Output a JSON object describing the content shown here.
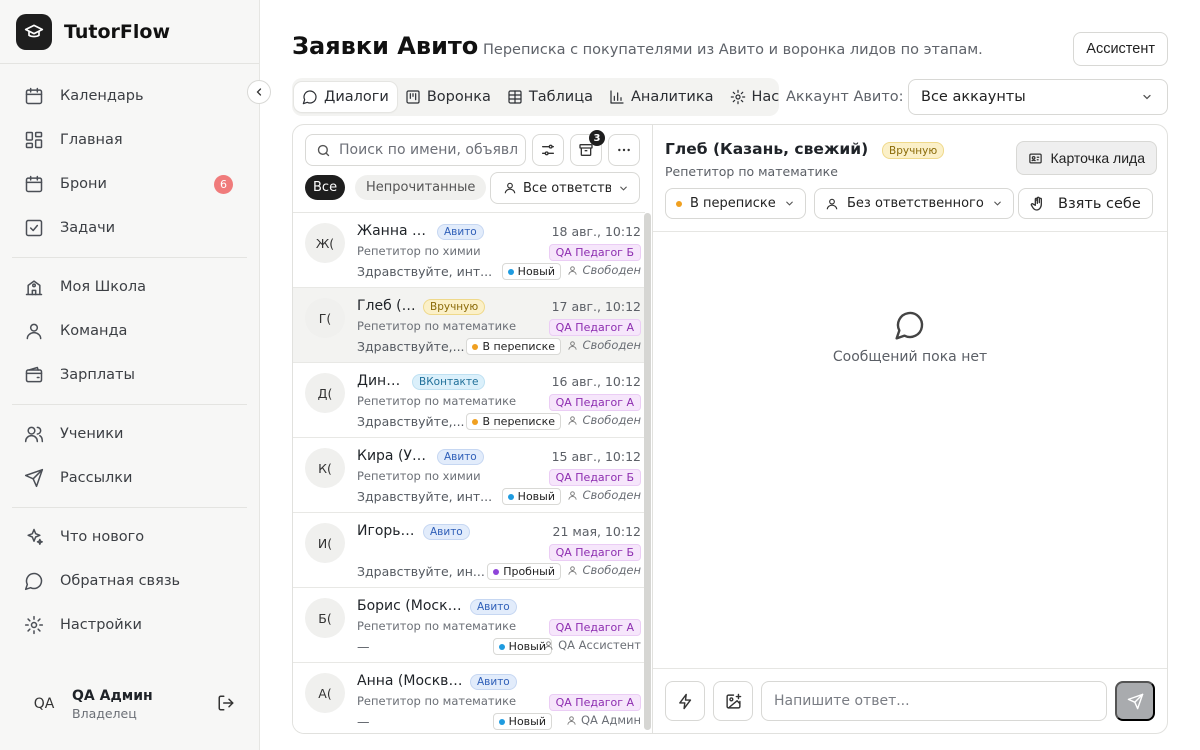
{
  "app": {
    "name": "TutorFlow"
  },
  "sidebar": {
    "groups": [
      [
        {
          "label": "Календарь",
          "icon": "calendar-icon"
        },
        {
          "label": "Главная",
          "icon": "dashboard-icon"
        },
        {
          "label": "Брони",
          "icon": "calendar-icon",
          "badge": "6"
        },
        {
          "label": "Задачи",
          "icon": "checkbox-icon"
        }
      ],
      [
        {
          "label": "Моя Школа",
          "icon": "school-icon"
        },
        {
          "label": "Команда",
          "icon": "user-icon"
        },
        {
          "label": "Зарплаты",
          "icon": "wallet-icon"
        }
      ],
      [
        {
          "label": "Ученики",
          "icon": "users-icon"
        },
        {
          "label": "Рассылки",
          "icon": "send-icon"
        }
      ],
      [
        {
          "label": "Что нового",
          "icon": "sparkles-icon"
        },
        {
          "label": "Обратная связь",
          "icon": "chat-bubble-icon"
        },
        {
          "label": "Настройки",
          "icon": "gear-icon"
        }
      ]
    ],
    "user": {
      "initials": "QA",
      "name": "QA Админ",
      "role": "Владелец"
    }
  },
  "header": {
    "title": "Заявки Авито",
    "subtitle": "Переписка с покупателями из Авито и воронка лидов по этапам.",
    "assistant_label": "Ассистент"
  },
  "tabs": [
    {
      "label": "Диалоги",
      "icon": "chat-bubble-icon",
      "active": true
    },
    {
      "label": "Воронка",
      "icon": "kanban-icon"
    },
    {
      "label": "Таблица",
      "icon": "table-icon"
    },
    {
      "label": "Аналитика",
      "icon": "bar-chart-icon"
    },
    {
      "label": "Нас",
      "icon": "gear-icon"
    }
  ],
  "account": {
    "label": "Аккаунт Авито:",
    "value": "Все аккаунты"
  },
  "list": {
    "search_placeholder": "Поиск по имени, объявлению",
    "archive_count": "3",
    "filters": {
      "all": "Все",
      "unread": "Непрочитанные"
    },
    "responsible": "Все ответственные",
    "items": [
      {
        "initials": "Ж(",
        "name": "Жанна (СПб, св...",
        "source": "Авито",
        "source_type": "avito",
        "time": "18 авг., 10:12",
        "subject": "Репетитор по химии",
        "teacher": "QA Педагог Б",
        "message": "Здравствуйте, инт...",
        "status": "Новый",
        "status_color": "#1e9be0",
        "assignee": "Свободен",
        "assignee_italic": true
      },
      {
        "initials": "Г(",
        "name": "Глеб (Казань, ...",
        "source": "Вручную",
        "source_type": "manual",
        "time": "17 авг., 10:12",
        "subject": "Репетитор по математике",
        "teacher": "QA Педагог А",
        "message": "Здравствуйте,...",
        "status": "В переписке",
        "status_color": "#f0a020",
        "assignee": "Свободен",
        "assignee_italic": true,
        "selected": true
      },
      {
        "initials": "Д(",
        "name": "Дина (без го...",
        "source": "ВКонтакте",
        "source_type": "vk",
        "time": "16 авг., 10:12",
        "subject": "Репетитор по математике",
        "teacher": "QA Педагог А",
        "message": "Здравствуйте,...",
        "status": "В переписке",
        "status_color": "#f0a020",
        "assignee": "Свободен",
        "assignee_italic": true
      },
      {
        "initials": "К(",
        "name": "Кира (Уфа, свеж...",
        "source": "Авито",
        "source_type": "avito",
        "time": "15 авг., 10:12",
        "subject": "Репетитор по химии",
        "teacher": "QA Педагог Б",
        "message": "Здравствуйте, инт...",
        "status": "Новый",
        "status_color": "#1e9be0",
        "assignee": "Свободен",
        "assignee_italic": true
      },
      {
        "initials": "И(",
        "name": "Игорь (Уфа, ста...",
        "source": "Авито",
        "source_type": "avito",
        "time": "21 мая, 10:12",
        "subject": "",
        "teacher": "QA Педагог Б",
        "message": "Здравствуйте, ин...",
        "status": "Пробный",
        "status_color": "#8e44d9",
        "assignee": "Свободен",
        "assignee_italic": true
      },
      {
        "initials": "Б(",
        "name": "Борис (Москва, месяц)",
        "source": "Авито",
        "source_type": "avito",
        "time": "",
        "subject": "Репетитор по математике",
        "teacher": "QA Педагог А",
        "message": "—",
        "status": "Новый",
        "status_color": "#1e9be0",
        "assignee": "QA Ассистент",
        "assignee_italic": false
      },
      {
        "initials": "А(",
        "name": "Анна (Москва, свежая)",
        "source": "Авито",
        "source_type": "avito",
        "time": "",
        "subject": "Репетитор по математике",
        "teacher": "QA Педагог А",
        "message": "—",
        "status": "Новый",
        "status_color": "#1e9be0",
        "assignee": "QA Админ",
        "assignee_italic": false
      }
    ]
  },
  "chat": {
    "name": "Глеб (Казань, свежий)",
    "source": "Вручную",
    "subject": "Репетитор по математике",
    "card_button": "Карточка лида",
    "stage": "В переписке",
    "stage_color": "#f0a020",
    "responsible": "Без ответственного",
    "take_button": "Взять себе",
    "empty_text": "Сообщений пока нет",
    "reply_placeholder": "Напишите ответ..."
  }
}
